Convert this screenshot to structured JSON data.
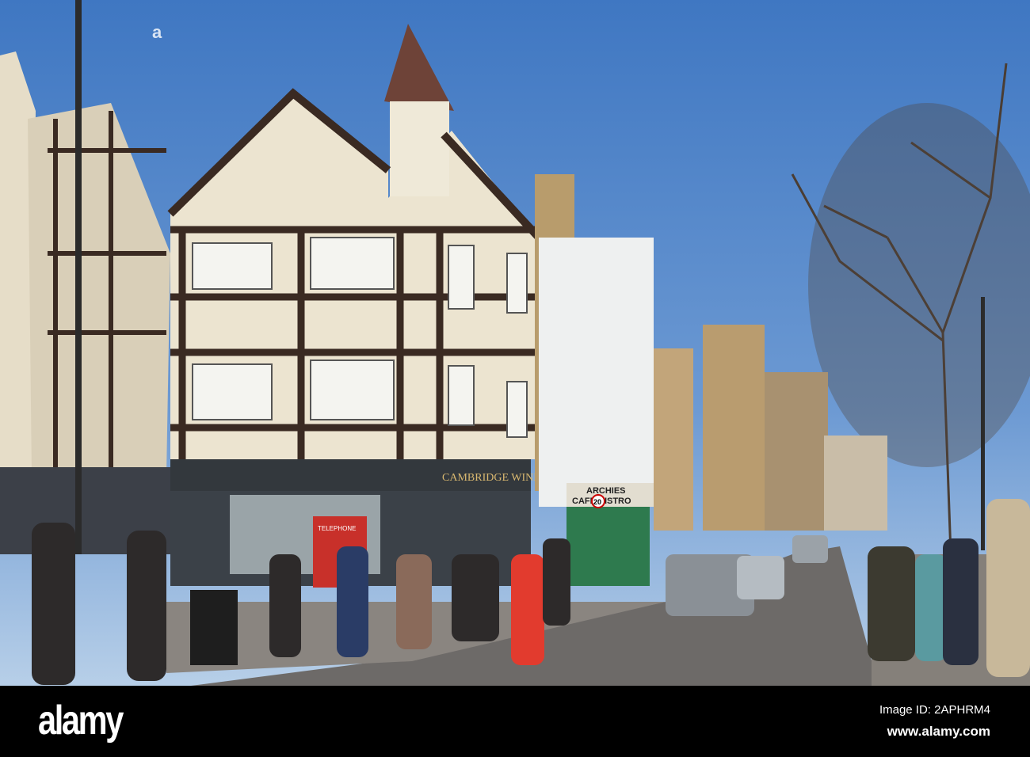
{
  "scene": {
    "shop_sign": "CAMBRIDGE WINE MERCHANTS",
    "cafe_sign_line1": "ARCHIES",
    "cafe_sign_line2": "CAFE BISTRO",
    "speed_limit": "20",
    "phone_box": "TELEPHONE",
    "colors": {
      "sky": "#4f86cc",
      "sky_low": "#a9c6e6",
      "timber": "#3a2a22",
      "render": "#e9e2cf",
      "road": "#6d6a68",
      "shopfront": "#33383d"
    }
  },
  "footer": {
    "logo": "alamy",
    "image_id": "Image ID: 2APHRM4",
    "url": "www.alamy.com"
  }
}
